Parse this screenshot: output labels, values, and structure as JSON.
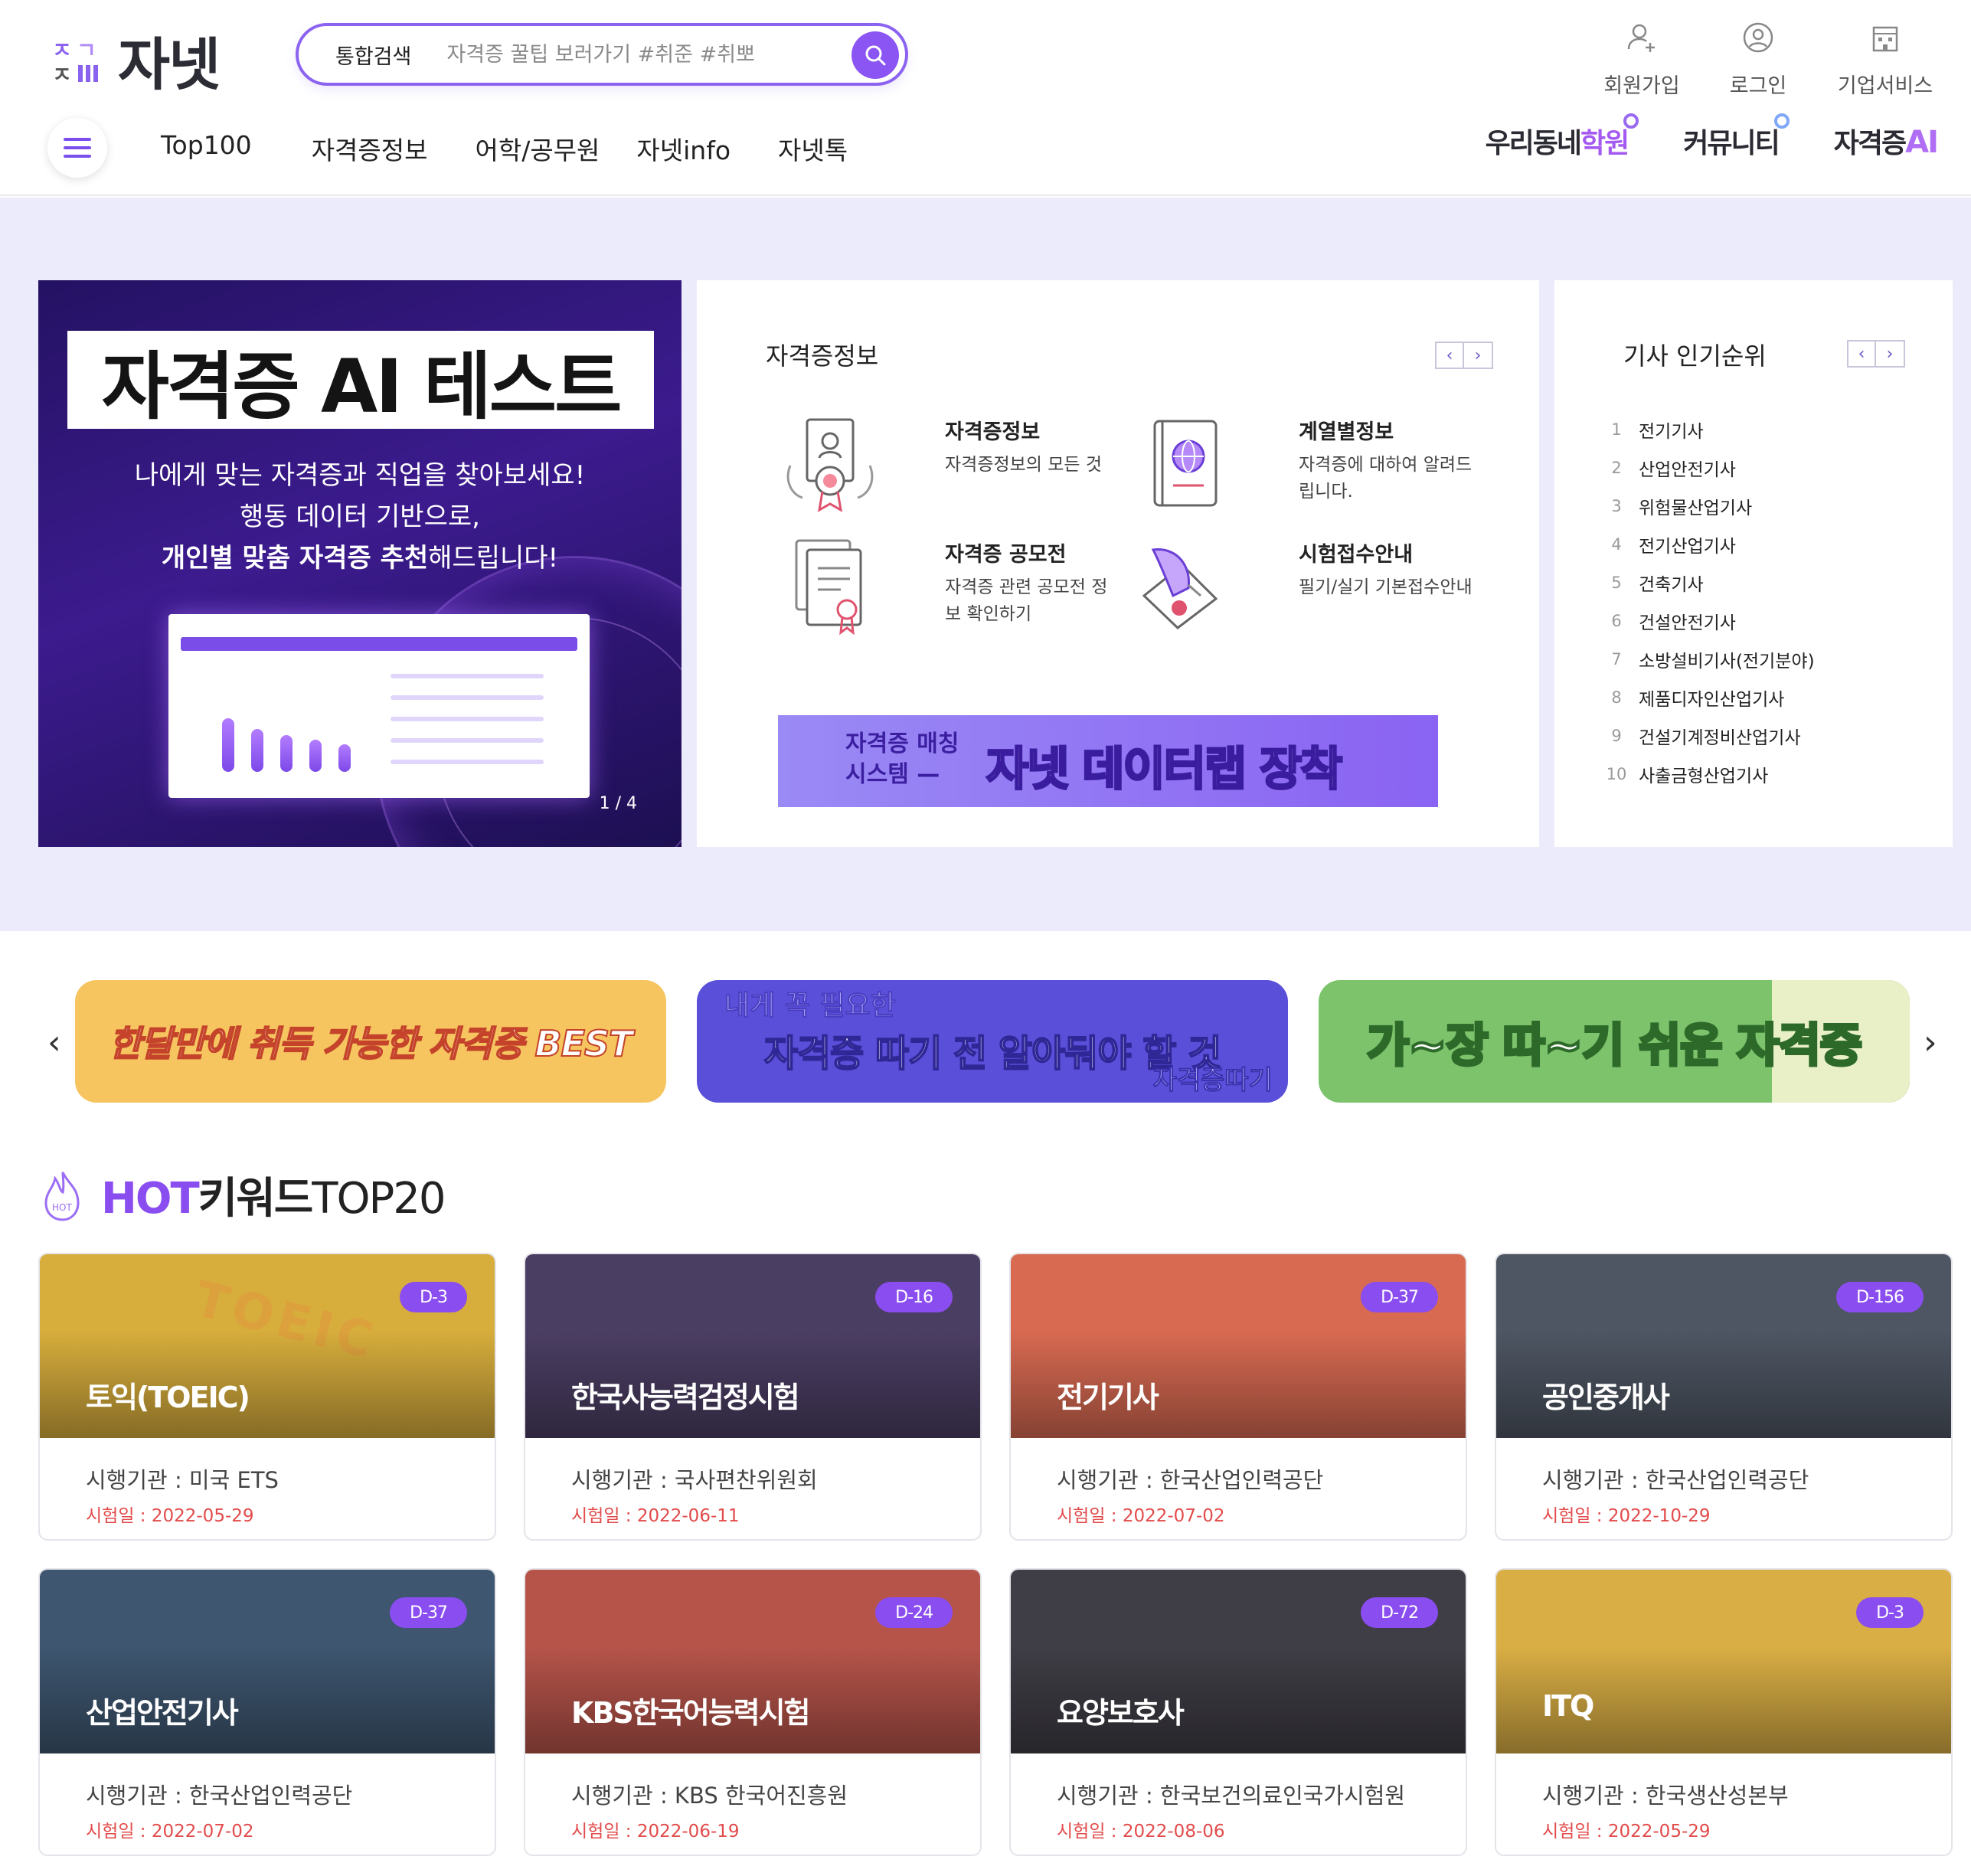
{
  "brand": {
    "logo_text": "자넷"
  },
  "search": {
    "category": "통합검색",
    "placeholder": "자격증 꿀팁 보러가기 #취준 #취뽀"
  },
  "top_links": [
    {
      "label": "회원가입",
      "icon": "user-plus-icon"
    },
    {
      "label": "로그인",
      "icon": "user-circle-icon"
    },
    {
      "label": "기업서비스",
      "icon": "building-icon"
    }
  ],
  "nav": [
    "Top100",
    "자격증정보",
    "어학/공무원",
    "자넷info",
    "자넷톡"
  ],
  "right_nav": {
    "academy": {
      "pre": "우리동네",
      "accent": "학원"
    },
    "community": "커뮤니티",
    "cert_ai": {
      "pre": "자격증",
      "accent": "AI"
    }
  },
  "hero": {
    "title": "자격증 AI 테스트",
    "sub_line1": "나에게 맞는 자격증과 직업을 찾아보세요!",
    "sub_line2": "행동 데이터 기반으로,",
    "sub_line3_bold": "개인별 맞춤 자격증 추천",
    "sub_line3_rest": "해드립니다!",
    "pager": "1 / 4"
  },
  "info_panel": {
    "title": "자격증정보",
    "items": [
      {
        "title": "자격증정보",
        "desc": "자격증정보의 모든 것",
        "icon": "certificate-award-icon"
      },
      {
        "title": "계열별정보",
        "desc": "자격증에 대하여 알려드립니다.",
        "icon": "globe-book-icon"
      },
      {
        "title": "자격증 공모전",
        "desc": "자격증 관련 공모전 정보 확인하기",
        "icon": "document-ribbon-icon"
      },
      {
        "title": "시험접수안내",
        "desc": "필기/실기 기본접수안내",
        "icon": "quill-scroll-icon"
      }
    ],
    "banner": {
      "small_line1": "자격증 매칭",
      "small_line2": "시스템 —",
      "big": "자넷 데이터랩 장착"
    }
  },
  "rank_panel": {
    "title": "기사 인기순위",
    "items": [
      "전기기사",
      "산업안전기사",
      "위험물산업기사",
      "전기산업기사",
      "건축기사",
      "건설안전기사",
      "소방설비기사(전기분야)",
      "제품디자인산업기사",
      "건설기계정비산업기사",
      "사출금형산업기사"
    ]
  },
  "promos": {
    "p1": "한달만에 취득 가능한 자격증 BEST",
    "p2_top": "내게 꼭 필요한",
    "p2_main": "자격증 따기 전 알아둬야 할 것",
    "p2_bottom": "자격증따기",
    "p3": "가~장 따~기 쉬운 자격증"
  },
  "hot": {
    "title_hot": "HOT",
    "title_keyword": "키워드",
    "title_top": "TOP20",
    "org_prefix": "시행기관 : ",
    "date_prefix": "시험일 : ",
    "cards": [
      {
        "name": "토익(TOEIC)",
        "dday": "D-3",
        "org": "시행기관 : 미국 ETS",
        "date": "시험일 : 2022-05-29",
        "color": "#d7ad3c",
        "image_text": "TOEIC"
      },
      {
        "name": "한국사능력검정시험",
        "dday": "D-16",
        "org": "시행기관 : 국사편찬위원회",
        "date": "시험일 : 2022-06-11",
        "color": "#4b3e63"
      },
      {
        "name": "전기기사",
        "dday": "D-37",
        "org": "시행기관 : 한국산업인력공단",
        "date": "시험일 : 2022-07-02",
        "color": "#d86a52"
      },
      {
        "name": "공인중개사",
        "dday": "D-156",
        "org": "시행기관 : 한국산업인력공단",
        "date": "시험일 : 2022-10-29",
        "color": "#4e5663"
      },
      {
        "name": "산업안전기사",
        "dday": "D-37",
        "org": "시행기관 : 한국산업인력공단",
        "date": "시험일 : 2022-07-02",
        "color": "#3e5670"
      },
      {
        "name": "KBS한국어능력시험",
        "dday": "D-24",
        "org": "시행기관 : KBS 한국어진흥원",
        "date": "시험일 : 2022-06-19",
        "color": "#b6544a"
      },
      {
        "name": "요양보호사",
        "dday": "D-72",
        "org": "시행기관 : 한국보건의료인국가시험원",
        "date": "시험일 : 2022-08-06",
        "color": "#3f3d45"
      },
      {
        "name": "ITQ",
        "dday": "D-3",
        "org": "시행기관 : 한국생산성본부",
        "date": "시험일 : 2022-05-29",
        "color": "#d9ae44"
      }
    ]
  },
  "colors": {
    "accent": "#8b55f4",
    "hero_bg": "#ecebfb",
    "date_red": "#e24b4b"
  }
}
